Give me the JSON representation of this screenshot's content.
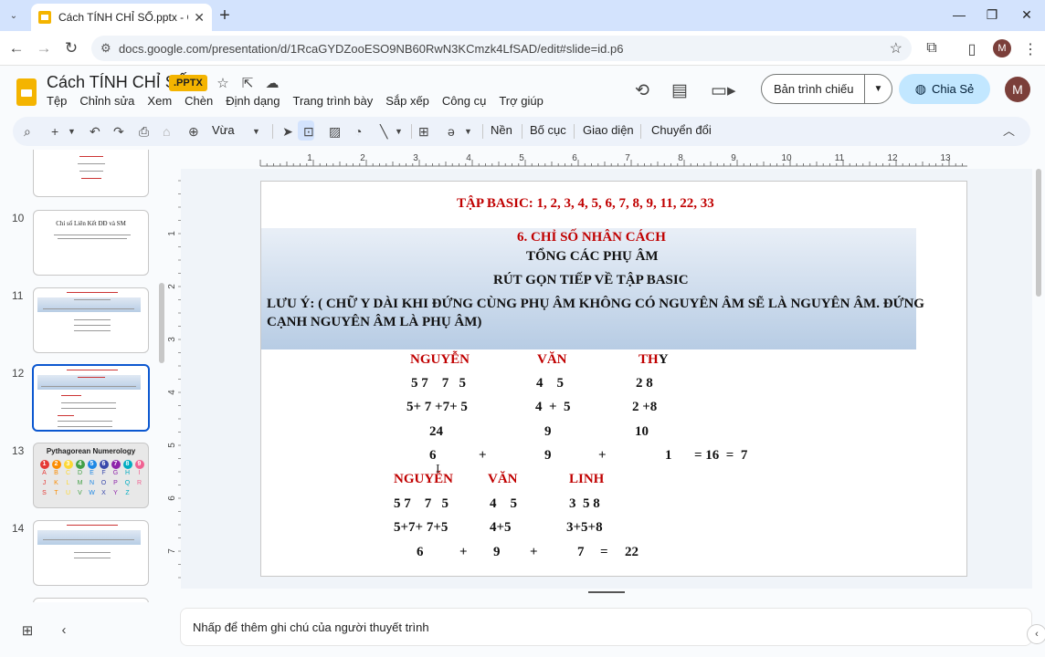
{
  "browser": {
    "tab_title": "Cách TÍNH CHỈ SỐ.pptx - Google",
    "url": "docs.google.com/presentation/d/1RcaGYDZooESO9NB60RwN3KCmzk4LfSAD/edit#slide=id.p6",
    "profile_initial": "M"
  },
  "doc": {
    "title": "Cách TÍNH CHỈ SỐ",
    "badge": ".PPTX",
    "menu": [
      "Tệp",
      "Chỉnh sửa",
      "Xem",
      "Chèn",
      "Định dạng",
      "Trang trình bày",
      "Sắp xếp",
      "Công cụ",
      "Trợ giúp"
    ],
    "present_label": "Bản trình chiếu",
    "share_label": "Chia Sẻ",
    "avatar_initial": "M"
  },
  "toolbar": {
    "zoom": "Vừa",
    "background": "Nền",
    "layout": "Bố cục",
    "theme": "Giao diện",
    "transition": "Chuyển đổi"
  },
  "ruler": {
    "top": [
      "1",
      "2",
      "3",
      "4",
      "5",
      "6",
      "7",
      "8",
      "9",
      "10",
      "11",
      "12",
      "13"
    ],
    "left": [
      "1",
      "2",
      "3",
      "4",
      "5",
      "6",
      "7"
    ]
  },
  "filmstrip": {
    "numbers": [
      "10",
      "11",
      "12",
      "13",
      "14"
    ],
    "slide10_title": "Chỉ số Liên Kết  ĐĐ và SM",
    "slide13_title": "Pythagorean Numerology",
    "pyth_nums": [
      "1",
      "2",
      "3",
      "4",
      "5",
      "6",
      "7",
      "8",
      "9"
    ],
    "pyth_rows": [
      [
        "A",
        "B",
        "C",
        "D",
        "E",
        "F",
        "G",
        "H",
        "I"
      ],
      [
        "J",
        "K",
        "L",
        "M",
        "N",
        "O",
        "P",
        "Q",
        "R"
      ],
      [
        "S",
        "T",
        "U",
        "V",
        "W",
        "X",
        "Y",
        "Z",
        ""
      ]
    ],
    "pyth_colors": [
      "#e53935",
      "#fb8c00",
      "#fdd835",
      "#43a047",
      "#1e88e5",
      "#3949ab",
      "#8e24aa",
      "#00acc1",
      "#f06292"
    ]
  },
  "slide": {
    "heading": "TẬP BASIC: 1, 2, 3, 4, 5, 6, 7, 8, 9, 11, 22, 33",
    "section_title": "6. CHỈ SỐ NHÂN CÁCH",
    "line1": "TỔNG CÁC PHỤ ÂM",
    "line2": "RÚT GỌN TIẾP VỀ TẬP BASIC",
    "note_line1": "LƯU Ý:  ( CHỮ Y DÀI KHI ĐỨNG CÙNG PHỤ ÂM KHÔNG CÓ NGUYÊN ÂM SẼ LÀ NGUYÊN ÂM. ĐỨNG",
    "note_line2": "CẠNH NGUYÊN ÂM LÀ PHỤ ÂM)",
    "ex1": {
      "name1": "NGUYỄN",
      "name2": "VĂN",
      "name3_red": "TH",
      "name3_blk": "Y",
      "r1": [
        "5 7    7   5",
        "4    5",
        "2 8"
      ],
      "r2": [
        "5+ 7 +7+ 5",
        "4  +  5",
        "2 +8"
      ],
      "r3": [
        "24",
        "9",
        "10"
      ],
      "r4": [
        "6",
        "+",
        "9",
        "+",
        "1",
        "= 16  =  7"
      ]
    },
    "ex2": {
      "name1": "NGUYỄN",
      "name2": "VĂN",
      "name3": "LINH",
      "r1": [
        "5 7    7   5",
        "4    5",
        "3  5 8"
      ],
      "r2": [
        "5+7+ 7+5",
        "4+5",
        "3+5+8"
      ],
      "r3": [
        "6",
        "+",
        "9",
        "+",
        "7",
        "=",
        "22"
      ]
    }
  },
  "notes_placeholder": "Nhấp để thêm ghi chú của người thuyết trình"
}
